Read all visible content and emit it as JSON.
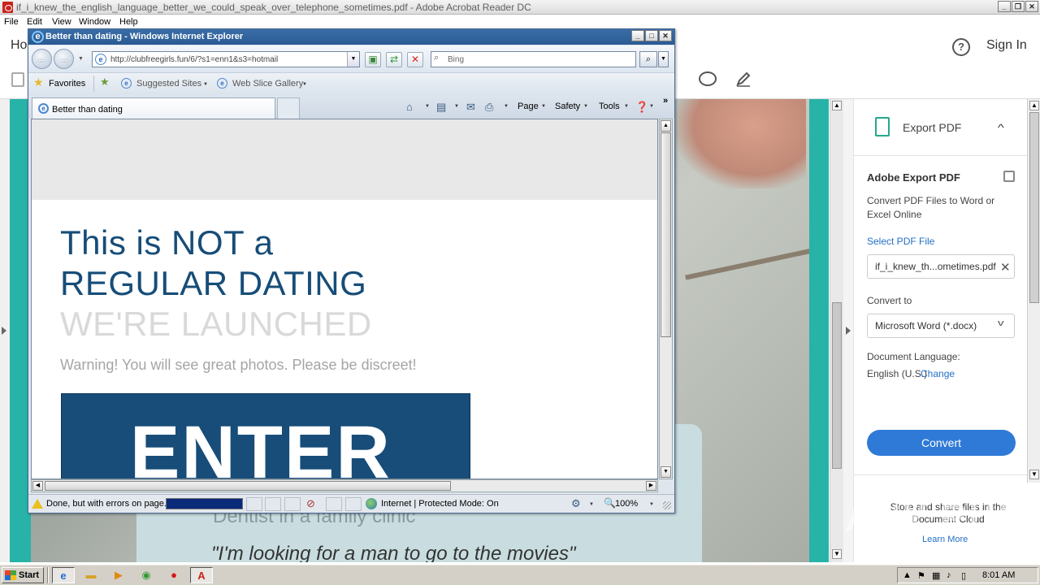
{
  "acrobat": {
    "title": "if_i_knew_the_english_language_better_we_could_speak_over_telephone_sometimes.pdf - Adobe Acrobat Reader DC",
    "menu": [
      "File",
      "Edit",
      "View",
      "Window",
      "Help"
    ],
    "home_tab": "Ho",
    "help_icon": "?",
    "sign_in": "Sign In"
  },
  "document": {
    "card_line1": "Dentist in a family clinic",
    "card_line2": "\"I'm looking for a man to go to the movies\""
  },
  "export_pane": {
    "header": "Export PDF",
    "title": "Adobe Export PDF",
    "description": "Convert PDF Files to Word or Excel Online",
    "select_label": "Select PDF File",
    "file_name": "if_i_knew_th...ometimes.pdf",
    "convert_to_label": "Convert to",
    "format": "Microsoft Word (*.docx)",
    "language_label": "Document Language:",
    "language": "English (U.S.)",
    "change_link": "Change",
    "convert_button": "Convert",
    "store_text": "Store and share files in the Document Cloud",
    "learn_more": "Learn More"
  },
  "watermark": "ANY RUN",
  "ie": {
    "title": "Better than dating - Windows Internet Explorer",
    "url": "http://clubfreegirls.fun/6/?s1=enn1&s3=hotmail",
    "search_placeholder": "Bing",
    "favorites_label": "Favorites",
    "fav_items": [
      "Suggested Sites",
      "Web Slice Gallery"
    ],
    "tab_label": "Better than dating",
    "commands": [
      "Page",
      "Safety",
      "Tools"
    ],
    "status_text": "Done, but with errors on page.",
    "progress_fraction": 1.0,
    "zone_text": "Internet | Protected Mode: On",
    "zoom": "100%"
  },
  "page": {
    "headline_1": "This is NOT a",
    "headline_2": "REGULAR DATING",
    "headline_3": "WE'RE LAUNCHED",
    "warning": "Warning! You will see great photos. Please be discreet!",
    "enter_button": "ENTER"
  },
  "taskbar": {
    "start": "Start",
    "clock": "8:01 AM"
  }
}
